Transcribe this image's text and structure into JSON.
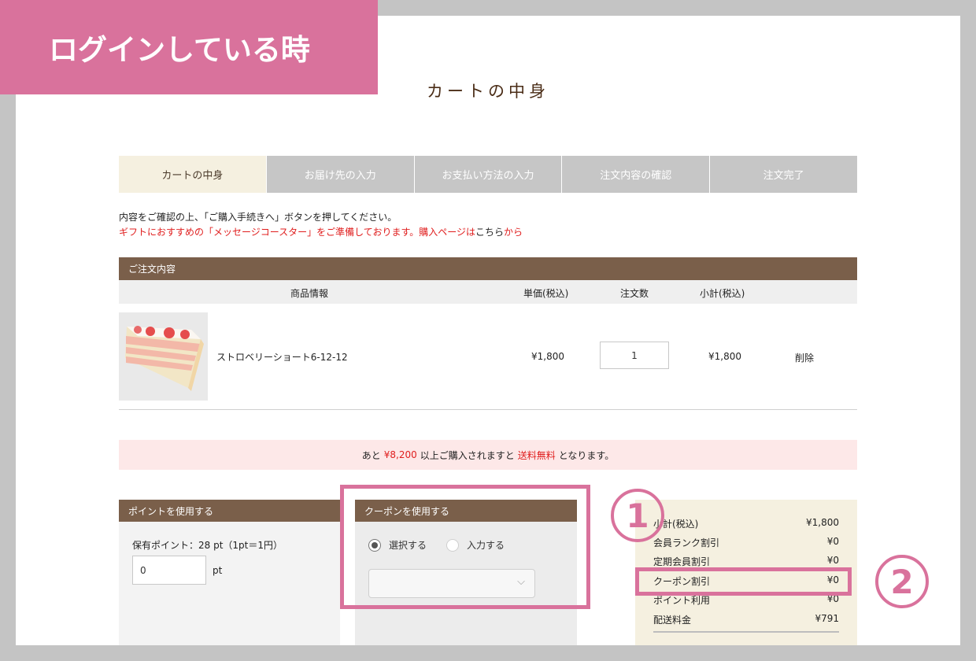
{
  "banner": {
    "text": "ログインしている時"
  },
  "page_title": "カートの中身",
  "steps": [
    "カートの中身",
    "お届け先の入力",
    "お支払い方法の入力",
    "注文内容の確認",
    "注文完了"
  ],
  "instructions": {
    "line1": "内容をご確認の上、「ご購入手続きへ」ボタンを押してください。",
    "line2_red": "ギフトにおすすめの「メッセージコースター」をご準備しております。購入ページは",
    "line2_link": "こちら",
    "line2_suffix": "から"
  },
  "order": {
    "header": "ご注文内容",
    "columns": {
      "product": "商品情報",
      "unit_price": "単価(税込)",
      "quantity": "注文数",
      "subtotal": "小計(税込)"
    },
    "items": [
      {
        "name": "ストロベリーショート6-12-12",
        "unit_price": "¥1,800",
        "quantity": "1",
        "subtotal": "¥1,800",
        "delete": "削除"
      }
    ]
  },
  "free_shipping_notice": {
    "prefix": "あと",
    "amount": "¥8,200",
    "middle": "以上ご購入されますと",
    "highlight": "送料無料",
    "suffix": "となります。"
  },
  "points": {
    "header": "ポイントを使用する",
    "held_label": "保有ポイント：28 pt（1pt＝1円）",
    "input_value": "0",
    "unit": "pt"
  },
  "coupon": {
    "header": "クーポンを使用する",
    "option_select": "選択する",
    "option_input": "入力する",
    "selected_option": "選択する",
    "select_value": ""
  },
  "summary": {
    "rows": [
      {
        "label": "小計(税込)",
        "value": "¥1,800"
      },
      {
        "label": "会員ランク割引",
        "value": "¥0"
      },
      {
        "label": "定期会員割引",
        "value": "¥0"
      },
      {
        "label": "クーポン割引",
        "value": "¥0"
      },
      {
        "label": "ポイント利用",
        "value": "¥0"
      },
      {
        "label": "配送料金",
        "value": "¥791"
      }
    ]
  },
  "callouts": [
    "1",
    "2"
  ],
  "colors": {
    "pink": "#d9729c",
    "brown": "#7a5f4a",
    "cream": "#f5f0e0",
    "red": "#e01e1e",
    "notice_bg": "#fde8e8"
  }
}
